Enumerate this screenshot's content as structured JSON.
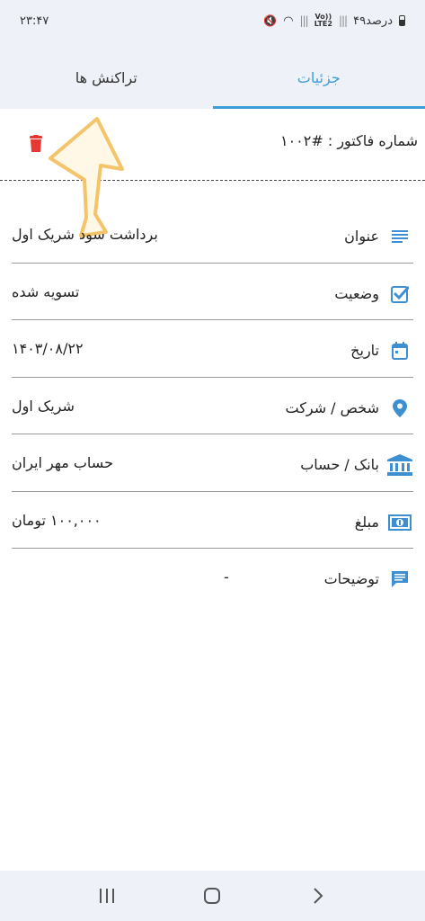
{
  "status_bar": {
    "time": "۲۳:۴۷",
    "battery_text": "۴۹درصد",
    "network": "Vo)) LTE2"
  },
  "tabs": [
    {
      "label": "تراکنش ها",
      "active": false
    },
    {
      "label": "جزئیات",
      "active": true
    }
  ],
  "invoice": {
    "label": "شماره فاکتور : #۱۰۰۲"
  },
  "fields": [
    {
      "icon": "subject-icon",
      "label": "عنوان",
      "value": "برداشت سود شریک اول"
    },
    {
      "icon": "checkbox-icon",
      "label": "وضعیت",
      "value": "تسویه شده"
    },
    {
      "icon": "calendar-icon",
      "label": "تاریخ",
      "value": "۱۴۰۳/۰۸/۲۲"
    },
    {
      "icon": "location-pin-icon",
      "label": "شخص / شرکت",
      "value": "شریک اول"
    },
    {
      "icon": "bank-icon",
      "label": "بانک / حساب",
      "value": "حساب مهر ایران"
    },
    {
      "icon": "money-icon",
      "label": "مبلغ",
      "value": "۱۰۰,۰۰۰ تومان"
    },
    {
      "icon": "comment-icon",
      "label": "توضیحات",
      "value": "-"
    }
  ],
  "colors": {
    "accent": "#3d9fd9",
    "danger": "#e53935",
    "icon_blue": "#3d8fd1",
    "arrow_fill": "#fff8e6",
    "arrow_stroke": "#f4c46a"
  }
}
